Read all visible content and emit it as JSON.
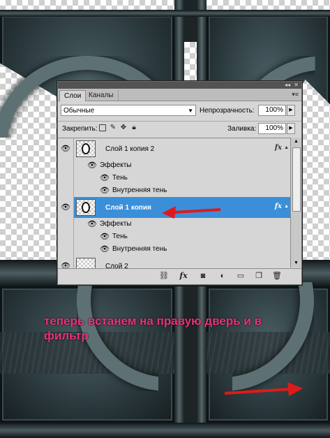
{
  "panel": {
    "tabs": [
      "Слои",
      "Каналы"
    ],
    "blend_mode": "Обычные",
    "opacity_label": "Непрозрачность:",
    "opacity_value": "100%",
    "lock_label": "Закрепить:",
    "fill_label": "Заливка:",
    "fill_value": "100%",
    "layers": [
      {
        "name": "Слой 1 копия 2",
        "effects_label": "Эффекты",
        "effects": [
          "Тень",
          "Внутренняя тень"
        ],
        "selected": false,
        "fx": "fx"
      },
      {
        "name": "Слой 1 копия",
        "effects_label": "Эффекты",
        "effects": [
          "Тень",
          "Внутренняя тень"
        ],
        "selected": true,
        "fx": "fx"
      },
      {
        "name": "Слой 2",
        "selected": false
      }
    ],
    "bottom_icons": [
      "link-icon",
      "fx-icon",
      "mask-icon",
      "adjustment-icon",
      "folder-icon",
      "new-layer-icon",
      "trash-icon"
    ],
    "selection_color": "#3b8fd9"
  },
  "annotation": {
    "text": "теперь встанем на правую дверь и в фильтр",
    "color": "#e8337a"
  },
  "arrow_color": "#e01a1a"
}
